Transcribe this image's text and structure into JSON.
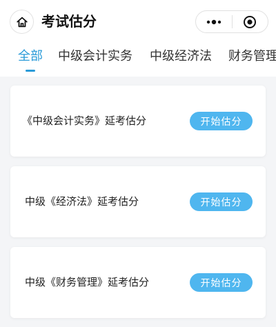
{
  "header": {
    "title": "考试估分",
    "home_icon": "home-icon",
    "menu_icon": "more-dots-icon",
    "close_icon": "capsule-close-icon"
  },
  "tabs": [
    {
      "label": "全部",
      "active": true
    },
    {
      "label": "中级会计实务",
      "active": false
    },
    {
      "label": "中级经济法",
      "active": false
    },
    {
      "label": "财务管理",
      "active": false
    }
  ],
  "cards": [
    {
      "title": "《中级会计实务》延考估分",
      "button": "开始估分"
    },
    {
      "title": "中级《经济法》延考估分",
      "button": "开始估分"
    },
    {
      "title": "中级《财务管理》延考估分",
      "button": "开始估分"
    }
  ],
  "colors": {
    "accent": "#2a9bd8",
    "button": "#4fb6ef",
    "background": "#f4f5f7"
  }
}
